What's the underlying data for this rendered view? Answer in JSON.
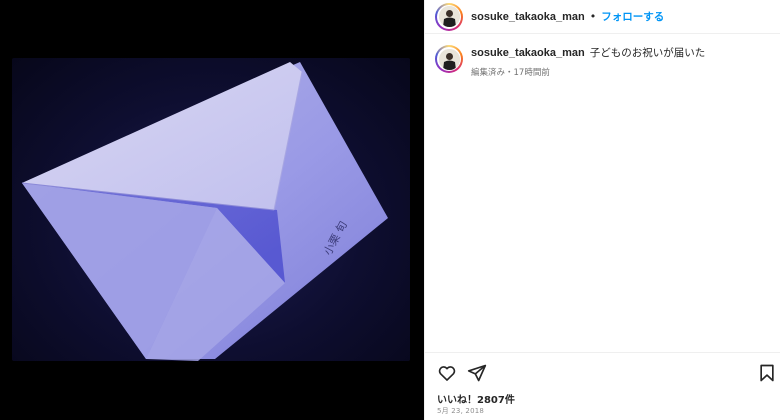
{
  "post": {
    "username": "sosuke_takaoka_man",
    "separator": "•",
    "follow_label": "フォローする",
    "caption": {
      "username": "sosuke_takaoka_man",
      "text": "子どものお祝いが届いた",
      "meta": "編集済み・17時間前"
    },
    "photo_handwriting": "小栗 旬",
    "likes": "いいね！2807件",
    "date": "5月 23, 2018"
  },
  "icons": {
    "like": "heart-icon",
    "share": "paper-plane-icon",
    "save": "bookmark-icon"
  },
  "colors": {
    "follow_blue": "#0095f6",
    "text_dark": "#262626",
    "meta_gray": "#737373",
    "media_background": "#000000"
  }
}
